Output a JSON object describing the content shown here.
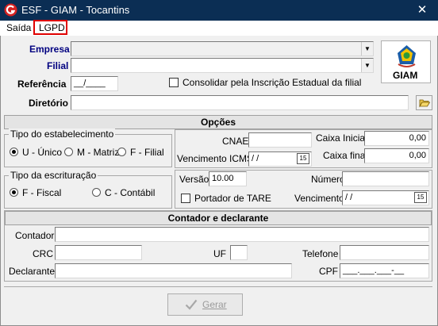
{
  "window": {
    "title": "ESF - GIAM - Tocantins",
    "close": "✕"
  },
  "menu": {
    "items": [
      "Saída",
      "LGPD"
    ]
  },
  "top": {
    "empresa_label": "Empresa",
    "filial_label": "Filial",
    "referencia_label": "Referência",
    "referencia_value": "__/____",
    "consolidar_label": "Consolidar pela Inscrição Estadual da filial",
    "diretorio_label": "Diretório",
    "logo_text": "GIAM"
  },
  "opcoes": {
    "header": "Opções",
    "tipo_estab_title": "Tipo do estabelecimento",
    "estab_options": [
      "U - Único",
      "M - Matriz",
      "F - Filial"
    ],
    "tipo_escrit_title": "Tipo da escrituração",
    "escrit_options": [
      "F - Fiscal",
      "C - Contábil"
    ],
    "cnae_label": "CNAE",
    "caixa_inicial_label": "Caixa Inicial",
    "caixa_inicial_value": "0,00",
    "venc_icms_label": "Vencimento ICMS",
    "venc_icms_value": " /  /",
    "caixa_final_label": "Caixa final",
    "caixa_final_value": "0,00",
    "versao_label": "Versão",
    "versao_value": "10.00",
    "numero_label": "Número",
    "portador_label": "Portador de TARE",
    "vencimento_label": "Vencimento",
    "vencimento_value": " /  /",
    "cal_label": "15"
  },
  "contador": {
    "header": "Contador e declarante",
    "contador_label": "Contador",
    "crc_label": "CRC",
    "uf_label": "UF",
    "telefone_label": "Telefone",
    "declarante_label": "Declarante",
    "cpf_label": "CPF",
    "cpf_value": "___.___.___-__"
  },
  "actions": {
    "gerar": "Gerar"
  },
  "colors": {
    "titlebar": "#0b2e54",
    "label_blue": "#000080",
    "highlight": "#e00000"
  }
}
